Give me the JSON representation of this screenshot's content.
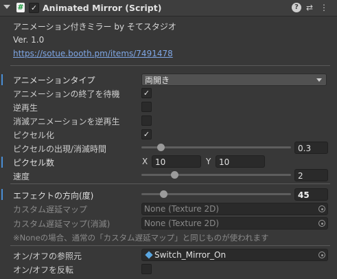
{
  "header": {
    "script_glyph": "#",
    "enabled_check": "✓",
    "title": "Animated Mirror (Script)",
    "help_glyph": "?",
    "presets_glyph": "⇄",
    "menu_glyph": "⋮"
  },
  "info": {
    "line1": "アニメーション付きミラー by そてスタジオ",
    "version": "Ver. 1.0",
    "url": "https://sotue.booth.pm/items/7491478"
  },
  "fields": {
    "anim_type": {
      "label": "アニメーションタイプ",
      "value": "両開き"
    },
    "wait_end": {
      "label": "アニメーションの終了を待機",
      "check": "✓"
    },
    "reverse": {
      "label": "逆再生",
      "check": ""
    },
    "reverse_hide": {
      "label": "消滅アニメーションを逆再生",
      "check": ""
    },
    "pixelate": {
      "label": "ピクセル化",
      "check": "✓"
    },
    "pixel_time": {
      "label": "ピクセルの出現/消滅時間",
      "value": "0.3",
      "fraction": 0.11
    },
    "pixel_count": {
      "label": "ピクセル数",
      "x_label": "X",
      "x": "10",
      "y_label": "Y",
      "y": "10"
    },
    "speed": {
      "label": "速度",
      "value": "2",
      "fraction": 0.21
    },
    "effect_dir": {
      "label": "エフェクトの方向(度)",
      "value": "45",
      "fraction": 0.13
    },
    "delay_map": {
      "label": "カスタム遅延マップ",
      "value": "None (Texture 2D)"
    },
    "delay_map_hide": {
      "label": "カスタム遅延マップ(消滅)",
      "value": "None (Texture 2D)"
    },
    "note": "※Noneの場合、通常の「カスタム遅延マップ」と同じものが使われます",
    "toggle_ref": {
      "label": "オン/オフの参照元",
      "value": "Switch_Mirror_On"
    },
    "toggle_invert": {
      "label": "オン/オフを反転",
      "check": ""
    }
  }
}
